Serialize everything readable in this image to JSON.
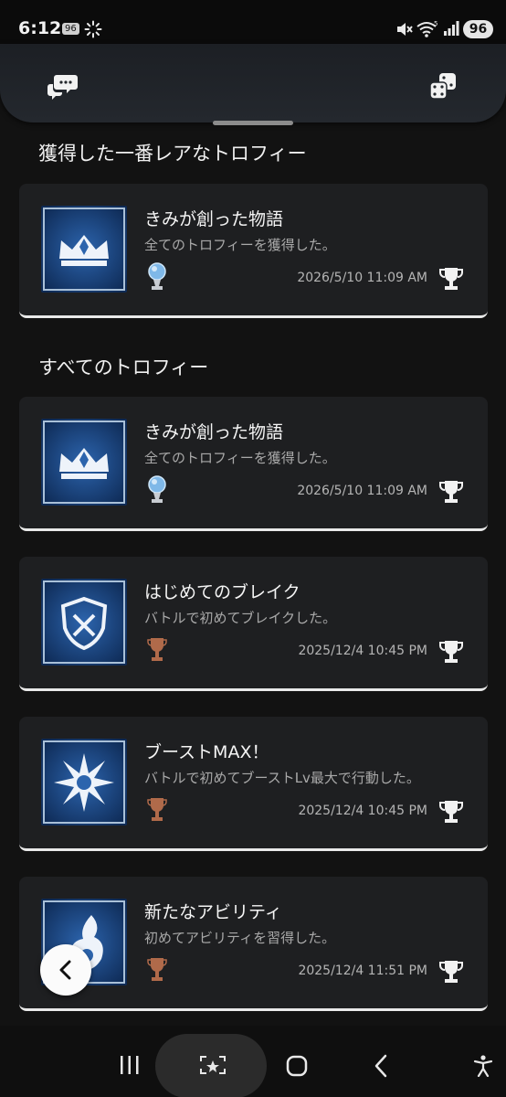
{
  "status_bar": {
    "time": "6:12",
    "small_badge": "96",
    "battery": "96",
    "icons": [
      "spinner-icon",
      "mute-icon",
      "wifi-icon",
      "signal-icon"
    ]
  },
  "header": {
    "left_icon": "chat-bubbles-icon",
    "right_icon": "dice-icon"
  },
  "sections": {
    "rarest_title": "獲得した一番レアなトロフィー",
    "all_title": "すべてのトロフィー"
  },
  "rarest": {
    "title": "きみが創った物語",
    "description": "全てのトロフィーを獲得した。",
    "date": "2026/5/10  11:09 AM",
    "grade": "platinum",
    "thumb": "crown"
  },
  "trophies": [
    {
      "title": "きみが創った物語",
      "description": "全てのトロフィーを獲得した。",
      "date": "2026/5/10  11:09 AM",
      "grade": "platinum",
      "thumb": "crown"
    },
    {
      "title": "はじめてのブレイク",
      "description": "バトルで初めてブレイクした。",
      "date": "2025/12/4  10:45 PM",
      "grade": "bronze",
      "thumb": "shield"
    },
    {
      "title": "ブーストMAX！",
      "description": "バトルで初めてブーストLv最大で行動した。",
      "date": "2025/12/4  10:45 PM",
      "grade": "bronze",
      "thumb": "burst"
    },
    {
      "title": "新たなアビリティ",
      "description": "初めてアビリティを習得した。",
      "date": "2025/12/4  11:51 PM",
      "grade": "bronze",
      "thumb": "flame"
    }
  ],
  "colors": {
    "background": "#121212",
    "card": "#1e1f21",
    "thumb_blue": "#1f4f8f",
    "bronze": "#b06a4a",
    "platinum": "#7fb8e8"
  },
  "nav": {
    "items": [
      "recents-icon",
      "capture-icon",
      "home-icon",
      "back-icon",
      "accessibility-icon"
    ]
  }
}
